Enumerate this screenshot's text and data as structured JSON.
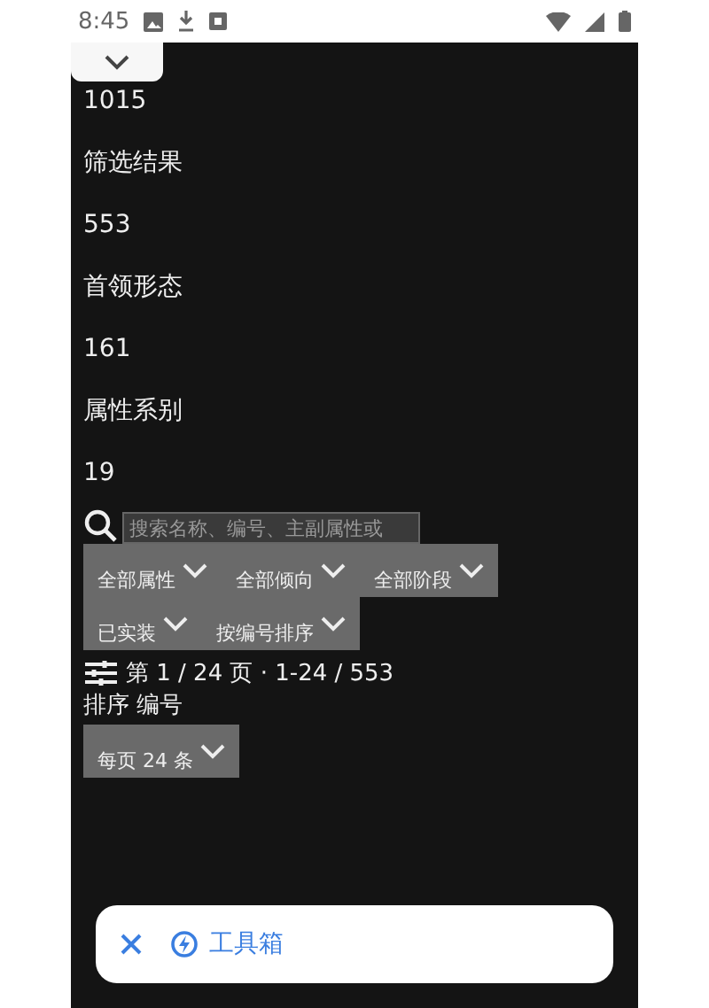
{
  "status_bar": {
    "time": "8:45"
  },
  "stats": [
    "1015",
    "筛选结果",
    "553",
    "首领形态",
    "161",
    "属性系别",
    "19"
  ],
  "search": {
    "placeholder": "搜索名称、编号、主副属性或"
  },
  "filters": [
    [
      "全部属性",
      "全部倾向",
      "全部阶段"
    ],
    [
      "已实装",
      "按编号排序"
    ]
  ],
  "pager": {
    "text": "第 1 / 24 页 · 1-24 / 553"
  },
  "sort_label": "排序 编号",
  "page_size": "每页 24 条",
  "toolbar": {
    "title": "工具箱"
  }
}
